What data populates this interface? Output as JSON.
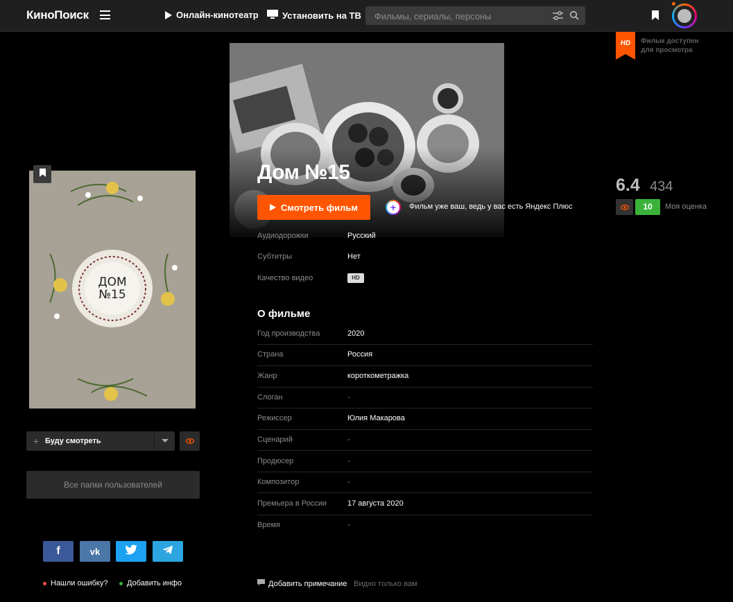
{
  "header": {
    "logo": "КиноПоиск",
    "nav_online": "Онлайн-кинотеатр",
    "nav_tv": "Установить на ТВ",
    "search_placeholder": "Фильмы, сериалы, персоны"
  },
  "hd_badge": {
    "line1": "Фильм доступен",
    "line2": "для просмотра"
  },
  "movie": {
    "title": "Дом №15",
    "watch_button": "Смотреть фильм",
    "plus_note": "Фильм уже ваш, ведь у вас есть Яндекс Плюс",
    "poster_text": "ДОМ №15"
  },
  "media": [
    {
      "label": "Аудиодорожки",
      "value": "Русский"
    },
    {
      "label": "Субтитры",
      "value": "Нет"
    },
    {
      "label": "Качество видео",
      "value": "HD"
    }
  ],
  "about": {
    "heading": "О фильме",
    "rows": [
      {
        "label": "Год производства",
        "value": "2020"
      },
      {
        "label": "Страна",
        "value": "Россия"
      },
      {
        "label": "Жанр",
        "value": "короткометражка"
      },
      {
        "label": "Слоган",
        "value": "-"
      },
      {
        "label": "Режиссер",
        "value": "Юлия Макарова"
      },
      {
        "label": "Сценарий",
        "value": "-"
      },
      {
        "label": "Продюсер",
        "value": "-"
      },
      {
        "label": "Композитор",
        "value": "-"
      },
      {
        "label": "Премьера в России",
        "value": "17 августа 2020"
      },
      {
        "label": "Время",
        "value": "-"
      }
    ]
  },
  "rating": {
    "value": "6.4",
    "votes": "434",
    "my_score": "10",
    "my_score_label": "Моя оценка"
  },
  "actions": {
    "will_watch": "Буду смотреть",
    "folders": "Все папки пользователей"
  },
  "footer": {
    "report_error": "Нашли ошибку?",
    "add_info": "Добавить инфо",
    "add_note": "Добавить примечание",
    "note_visibility": "Видно только вам"
  },
  "colors": {
    "accent": "#ff5500",
    "score": "#3bb33b",
    "bg": "#000000",
    "header": "#1f1f1f"
  }
}
